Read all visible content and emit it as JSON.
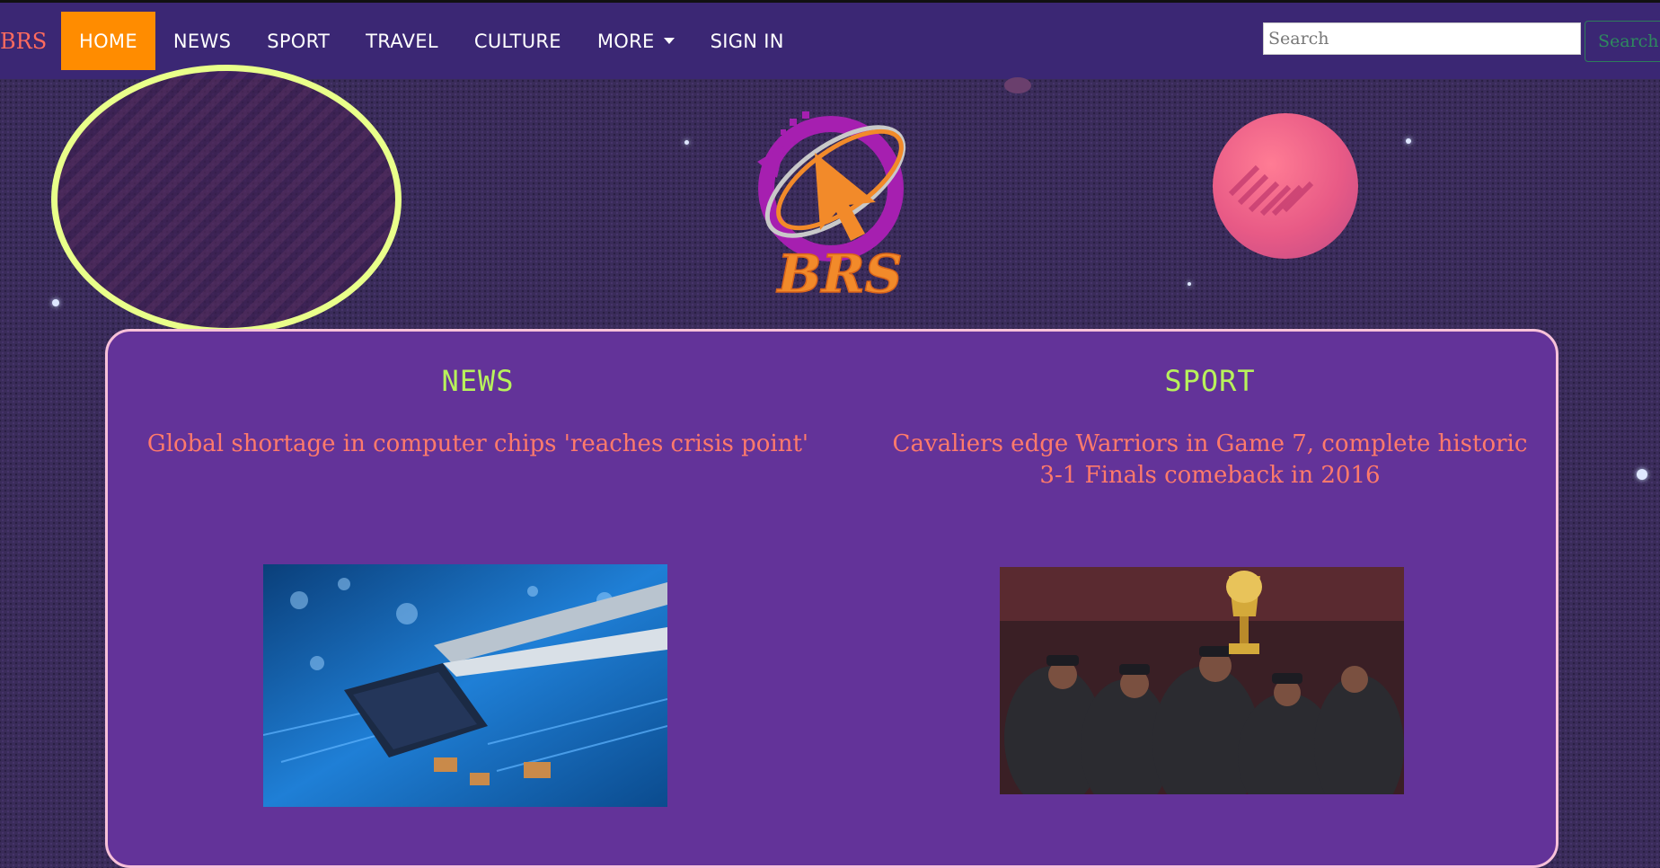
{
  "nav": {
    "brand": "BRS",
    "items": [
      {
        "label": "HOME",
        "active": true
      },
      {
        "label": "NEWS"
      },
      {
        "label": "SPORT"
      },
      {
        "label": "TRAVEL"
      },
      {
        "label": "CULTURE"
      },
      {
        "label": "MORE"
      },
      {
        "label": "SIGN IN"
      }
    ],
    "search": {
      "placeholder": "Search",
      "button_label": "Search"
    }
  },
  "logo": {
    "text": "BRS"
  },
  "sections": {
    "news": {
      "title": "NEWS",
      "headline": "Global shortage in computer chips 'reaches crisis point'",
      "image_icon": "circuit-board-chip-photo"
    },
    "sport": {
      "title": "SPORT",
      "headline": "Cavaliers edge Warriors in Game 7, complete historic 3-1 Finals comeback in 2016",
      "image_icon": "championship-trophy-celebration-photo"
    }
  },
  "colors": {
    "nav_bg": "#3b2774",
    "active_tab": "#ff8c00",
    "card_bg": "#633399",
    "card_border": "#f7c1d9",
    "section_title": "#b8f25b",
    "headline": "#ff7a6b",
    "brand": "#ff6b5e"
  }
}
